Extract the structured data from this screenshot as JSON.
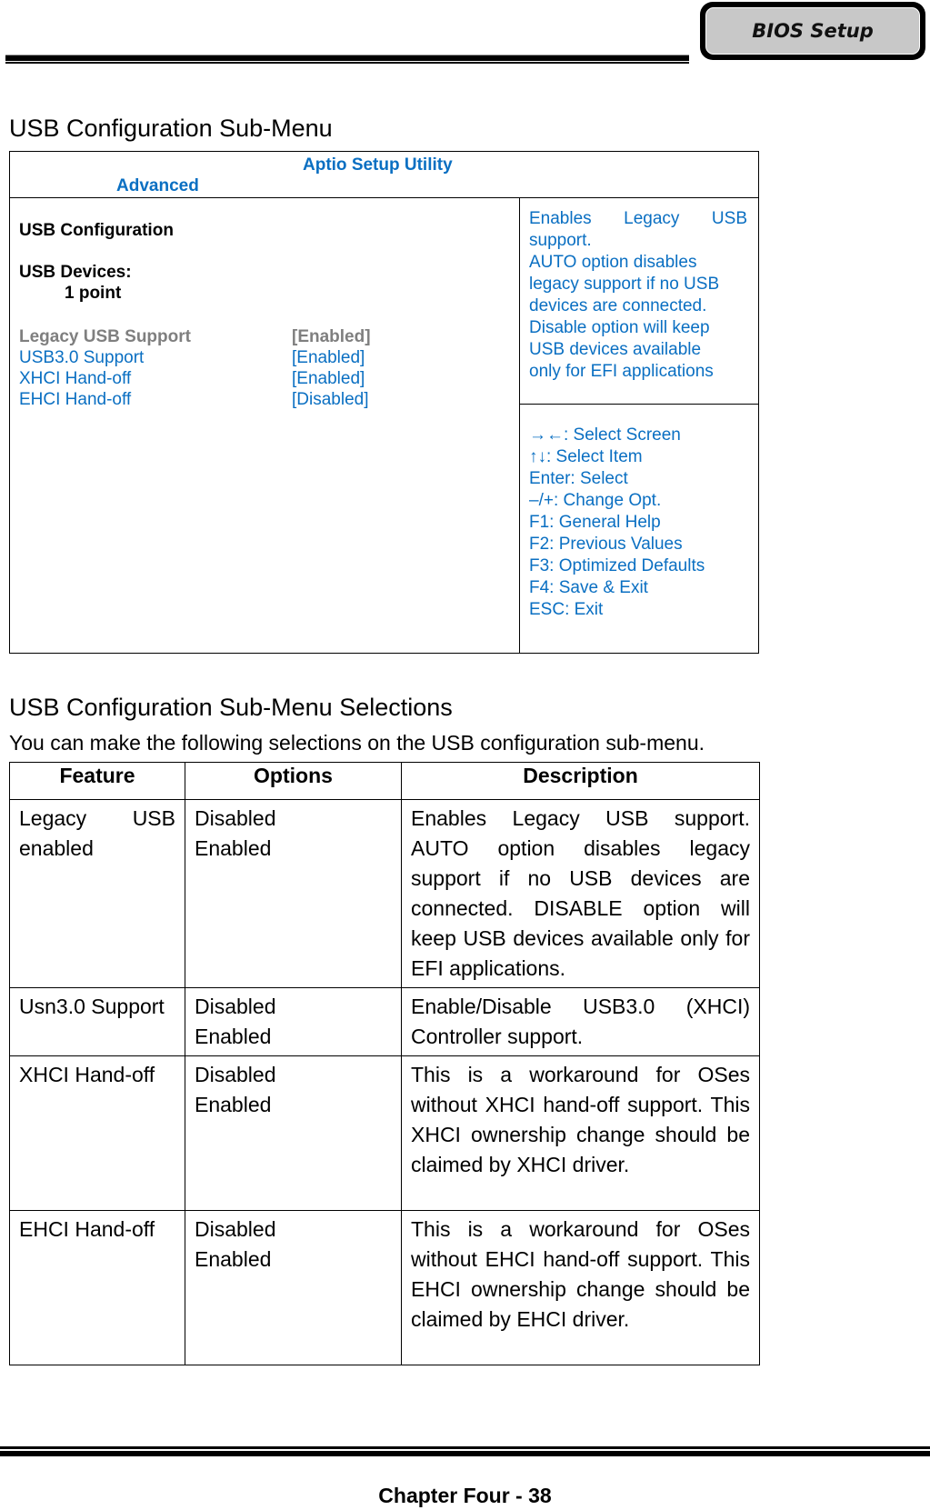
{
  "header": {
    "tab_label": "BIOS Setup"
  },
  "section1": {
    "title": "USB Configuration Sub-Menu"
  },
  "bios": {
    "utility_title": "Aptio Setup Utility",
    "active_tab": "Advanced",
    "screen_title": "USB Configuration",
    "devices_label": "USB Devices:",
    "devices_value": "1 point",
    "items": [
      {
        "label": "Legacy USB Support",
        "value": "[Enabled]",
        "selected": true
      },
      {
        "label": "USB3.0 Support",
        "value": "[Enabled]",
        "selected": false
      },
      {
        "label": "XHCI Hand-off",
        "value": "[Enabled]",
        "selected": false
      },
      {
        "label": "EHCI Hand-off",
        "value": "[Disabled]",
        "selected": false
      }
    ],
    "help": {
      "first_line": [
        "Enables",
        "Legacy",
        "USB"
      ],
      "lines": [
        "support.",
        "AUTO option disables",
        "legacy support if no USB",
        "devices are connected.",
        "Disable option will keep",
        "USB devices available",
        "only for EFI applications"
      ]
    },
    "keys": [
      "→←: Select Screen",
      "↑↓: Select Item",
      "Enter: Select",
      "–/+: Change Opt.",
      "F1: General Help",
      "F2: Previous Values",
      "F3: Optimized Defaults",
      "F4: Save & Exit",
      "ESC: Exit"
    ]
  },
  "section2": {
    "title": "USB Configuration Sub-Menu Selections",
    "intro": "You can make the following selections on the USB configuration sub-menu."
  },
  "table": {
    "headers": [
      "Feature",
      "Options",
      "Description"
    ],
    "rows": [
      {
        "feature": "Legacy USB enabled",
        "options": [
          "Disabled",
          "Enabled"
        ],
        "description": "Enables Legacy USB support. AUTO option disables legacy support if no USB devices are connected. DISABLE option will keep USB devices available only for EFI applications."
      },
      {
        "feature": "Usn3.0 Support",
        "options": [
          "Disabled",
          "Enabled"
        ],
        "description": "Enable/Disable USB3.0 (XHCI) Controller support."
      },
      {
        "feature": "XHCI Hand-off",
        "options": [
          "Disabled",
          "Enabled"
        ],
        "description": "This is a workaround for OSes without XHCI hand-off support. This XHCI ownership change should be claimed by XHCI driver."
      },
      {
        "feature": "EHCI Hand-off",
        "options": [
          "Disabled",
          "Enabled"
        ],
        "description": "This is a workaround for OSes without EHCI hand-off support. This EHCI ownership change should be claimed by EHCI driver."
      }
    ]
  },
  "footer": {
    "page_label": "Chapter Four - 38"
  }
}
